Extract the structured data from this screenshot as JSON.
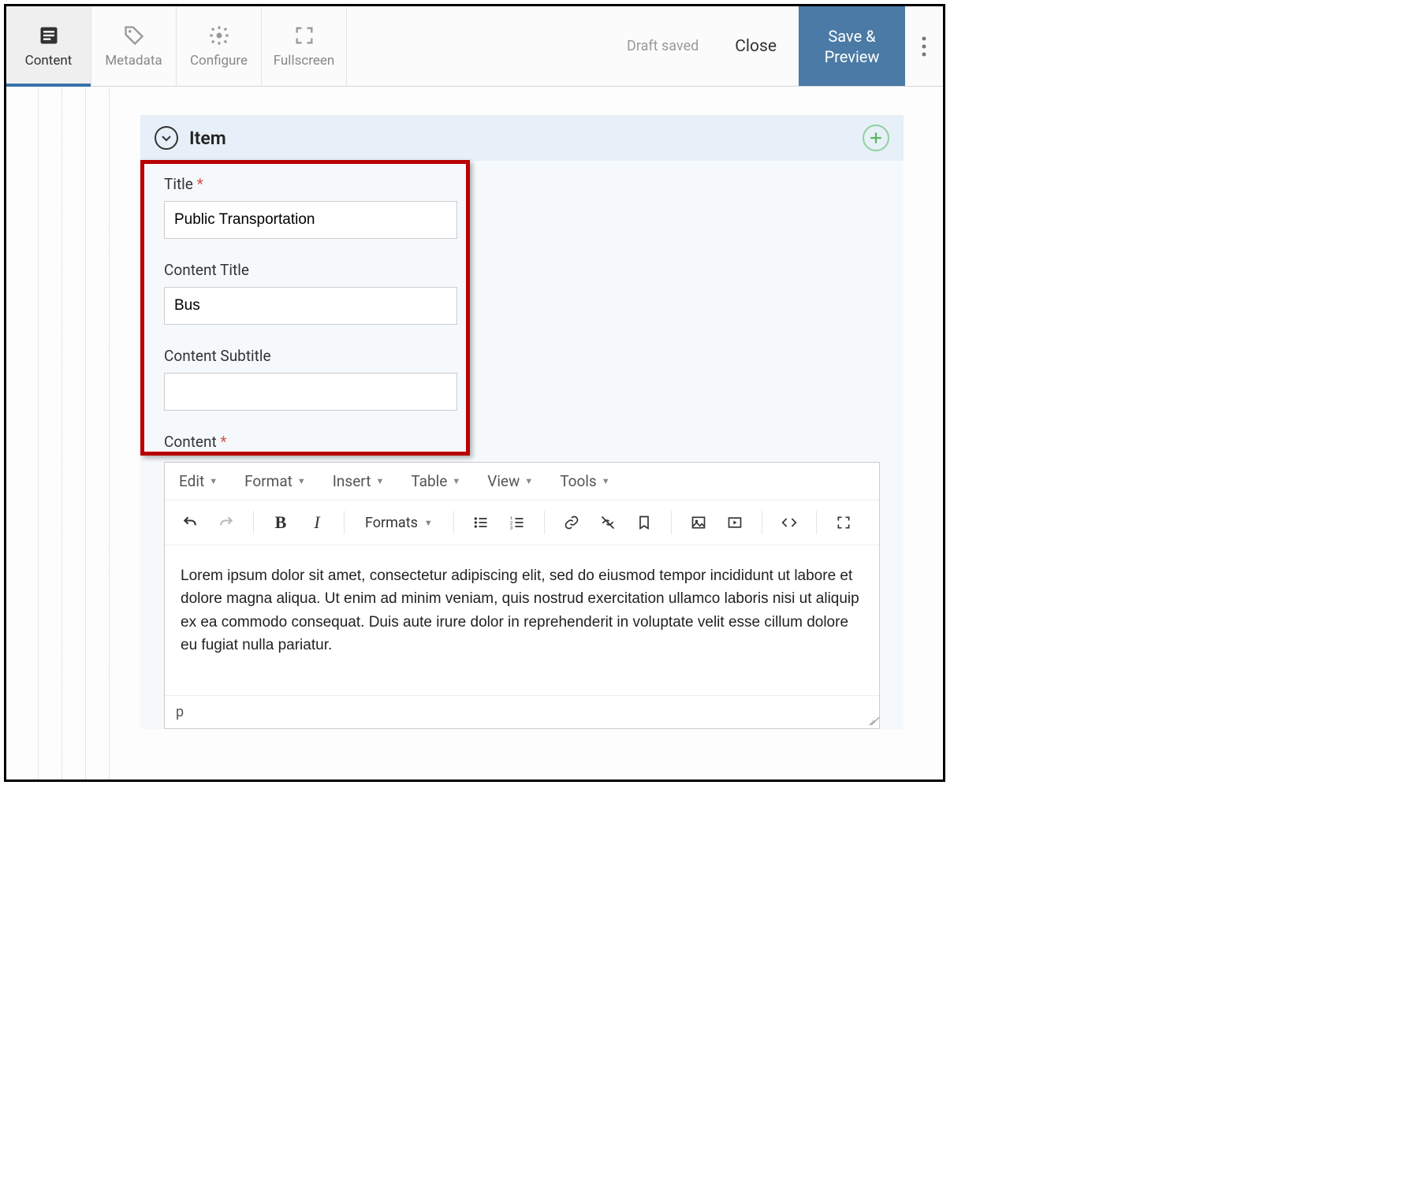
{
  "toolbar": {
    "tabs": [
      {
        "label": "Content"
      },
      {
        "label": "Metadata"
      },
      {
        "label": "Configure"
      },
      {
        "label": "Fullscreen"
      }
    ],
    "draft_status": "Draft saved",
    "close_label": "Close",
    "save_label": "Save &\nPreview"
  },
  "panel": {
    "title": "Item"
  },
  "fields": {
    "title": {
      "label": "Title",
      "value": "Public Transportation",
      "required": true
    },
    "content_title": {
      "label": "Content Title",
      "value": "Bus",
      "required": false
    },
    "content_subtitle": {
      "label": "Content Subtitle",
      "value": "",
      "required": false
    },
    "content": {
      "label": "Content",
      "required": true
    }
  },
  "editor": {
    "menus": [
      "Edit",
      "Format",
      "Insert",
      "Table",
      "View",
      "Tools"
    ],
    "formats_label": "Formats",
    "body": "Lorem ipsum dolor sit amet, consectetur adipiscing elit, sed do eiusmod tempor incididunt ut labore et dolore magna aliqua. Ut enim ad minim veniam, quis nostrud exercitation ullamco laboris nisi ut aliquip ex ea commodo consequat. Duis aute irure dolor in reprehenderit in voluptate velit esse cillum dolore eu fugiat nulla pariatur.",
    "status_path": "p"
  }
}
